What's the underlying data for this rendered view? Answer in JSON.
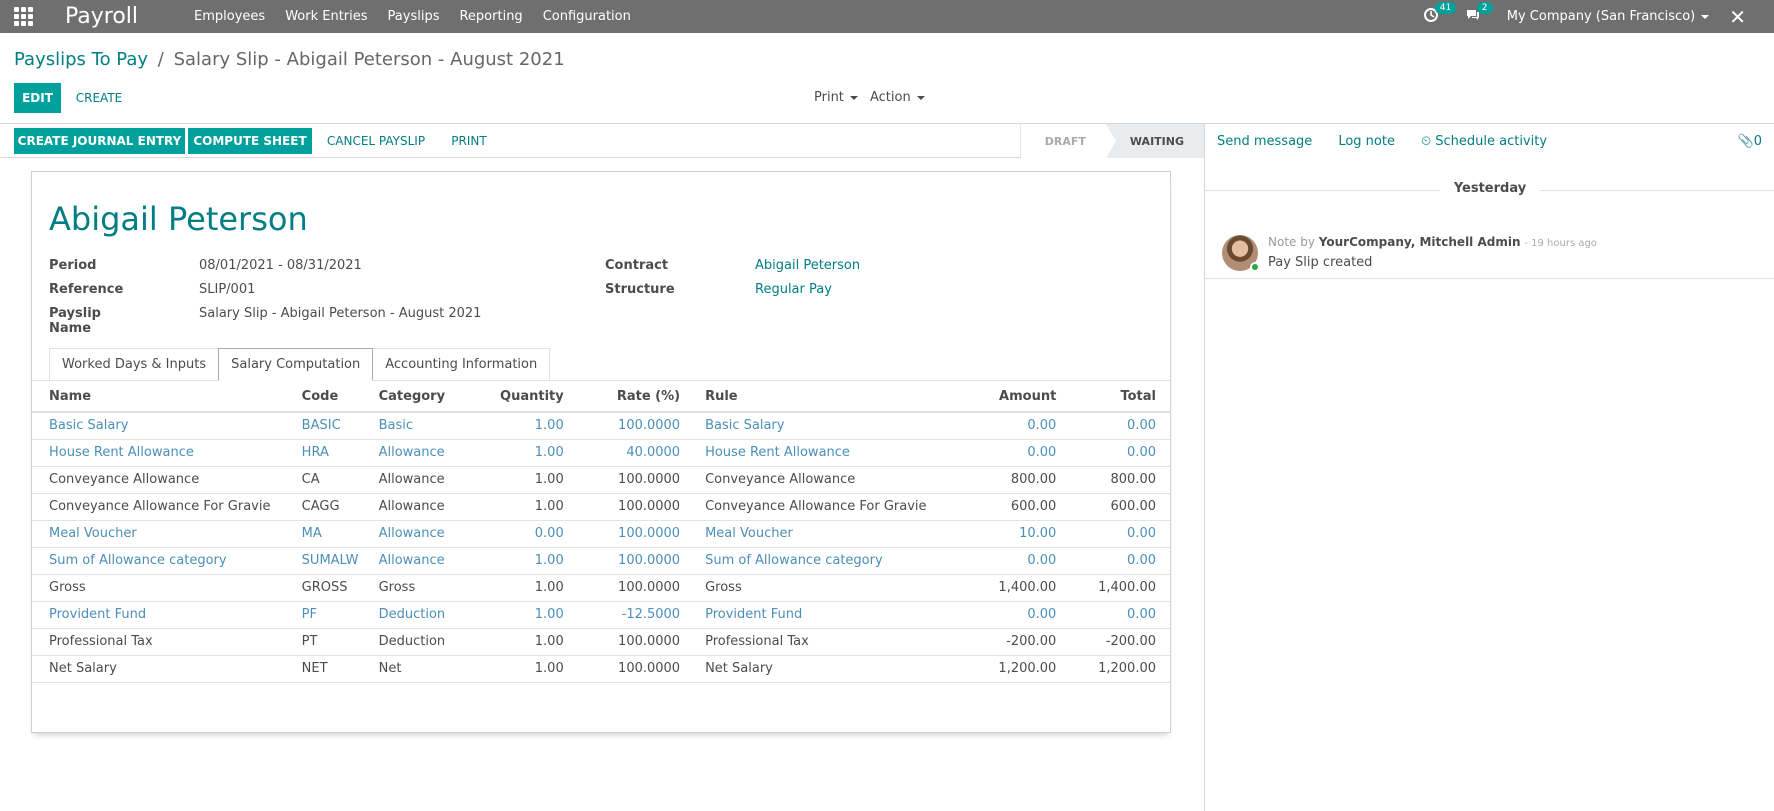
{
  "navbar": {
    "app_name": "Payroll",
    "menu": [
      "Employees",
      "Work Entries",
      "Payslips",
      "Reporting",
      "Configuration"
    ],
    "activity_count": "41",
    "message_count": "2",
    "company": "My Company (San Francisco)"
  },
  "breadcrumb": {
    "parent": "Payslips To Pay",
    "separator": "/",
    "current": "Salary Slip - Abigail Peterson - August 2021"
  },
  "control": {
    "edit": "EDIT",
    "create": "CREATE",
    "print": "Print",
    "action": "Action"
  },
  "statusbar": {
    "buttons": [
      "CREATE JOURNAL ENTRY",
      "COMPUTE SHEET",
      "CANCEL PAYSLIP",
      "PRINT"
    ],
    "stages": [
      "DRAFT",
      "WAITING"
    ],
    "active_stage": "WAITING"
  },
  "form": {
    "employee": "Abigail Peterson",
    "fields_left": [
      {
        "label": "Period",
        "value": "08/01/2021 - 08/31/2021"
      },
      {
        "label": "Reference",
        "value": "SLIP/001"
      },
      {
        "label": "Payslip Name",
        "value": "Salary Slip - Abigail Peterson - August 2021"
      }
    ],
    "fields_right": [
      {
        "label": "Contract",
        "value": "Abigail Peterson"
      },
      {
        "label": "Structure",
        "value": "Regular Pay"
      }
    ],
    "tabs": [
      "Worked Days & Inputs",
      "Salary Computation",
      "Accounting Information"
    ],
    "active_tab": "Salary Computation"
  },
  "table": {
    "headers": [
      "Name",
      "Code",
      "Category",
      "Quantity",
      "Rate (%)",
      "Rule",
      "Amount",
      "Total"
    ],
    "rows": [
      [
        "Basic Salary",
        "BASIC",
        "Basic",
        "1.00",
        "100.0000",
        "Basic Salary",
        "0.00",
        "0.00"
      ],
      [
        "House Rent Allowance",
        "HRA",
        "Allowance",
        "1.00",
        "40.0000",
        "House Rent Allowance",
        "0.00",
        "0.00"
      ],
      [
        "Conveyance Allowance",
        "CA",
        "Allowance",
        "1.00",
        "100.0000",
        "Conveyance Allowance",
        "800.00",
        "800.00"
      ],
      [
        "Conveyance Allowance For Gravie",
        "CAGG",
        "Allowance",
        "1.00",
        "100.0000",
        "Conveyance Allowance For Gravie",
        "600.00",
        "600.00"
      ],
      [
        "Meal Voucher",
        "MA",
        "Allowance",
        "0.00",
        "100.0000",
        "Meal Voucher",
        "10.00",
        "0.00"
      ],
      [
        "Sum of Allowance category",
        "SUMALW",
        "Allowance",
        "1.00",
        "100.0000",
        "Sum of Allowance category",
        "0.00",
        "0.00"
      ],
      [
        "Gross",
        "GROSS",
        "Gross",
        "1.00",
        "100.0000",
        "Gross",
        "1,400.00",
        "1,400.00"
      ],
      [
        "Provident Fund",
        "PF",
        "Deduction",
        "1.00",
        "-12.5000",
        "Provident Fund",
        "0.00",
        "0.00"
      ],
      [
        "Professional Tax",
        "PT",
        "Deduction",
        "1.00",
        "100.0000",
        "Professional Tax",
        "-200.00",
        "-200.00"
      ],
      [
        "Net Salary",
        "NET",
        "Net",
        "1.00",
        "100.0000",
        "Net Salary",
        "1,200.00",
        "1,200.00"
      ]
    ],
    "muted_rows": [
      0,
      1,
      4,
      5,
      7
    ]
  },
  "chatter": {
    "send_message": "Send message",
    "log_note": "Log note",
    "schedule_activity": "Schedule activity",
    "attachments": "0",
    "day": "Yesterday",
    "message": {
      "prefix": "Note by",
      "author": "YourCompany, Mitchell Admin",
      "time": "- 19 hours ago",
      "body": "Pay Slip created"
    }
  }
}
